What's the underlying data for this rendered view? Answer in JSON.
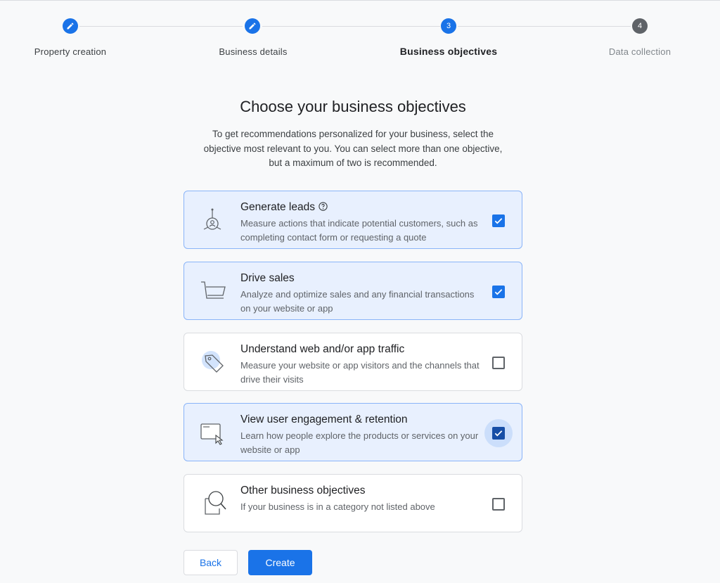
{
  "stepper": {
    "steps": [
      {
        "label": "Property creation",
        "state": "completed",
        "marker": "edit-icon"
      },
      {
        "label": "Business details",
        "state": "completed",
        "marker": "edit-icon"
      },
      {
        "label": "Business objectives",
        "state": "current",
        "number": "3"
      },
      {
        "label": "Data collection",
        "state": "upcoming",
        "number": "4"
      }
    ]
  },
  "page": {
    "title": "Choose your business objectives",
    "subtitle": "To get recommendations personalized for your business, select the objective most relevant to you. You can select more than one objective, but a maximum of two is recommended."
  },
  "objectives": [
    {
      "title": "Generate leads",
      "description": "Measure actions that indicate potential customers, such as completing contact form or requesting a quote",
      "checked": true,
      "icon": "leads-target-icon",
      "help_icon": "help-circle-icon"
    },
    {
      "title": "Drive sales",
      "description": "Analyze and optimize sales and any financial transactions on your website or app",
      "checked": true,
      "icon": "shopping-cart-icon"
    },
    {
      "title": "Understand web and/or app traffic",
      "description": "Measure your website or app visitors and the channels that drive their visits",
      "checked": false,
      "icon": "tag-icon"
    },
    {
      "title": "View user engagement & retention",
      "description": "Learn how people explore the products or services on your website or app",
      "checked": true,
      "icon": "browser-cursor-icon"
    },
    {
      "title": "Other business objectives",
      "description": "If your business is in a category not listed above",
      "checked": false,
      "icon": "magnifier-icon"
    }
  ],
  "buttons": {
    "back": "Back",
    "create": "Create"
  },
  "colors": {
    "accent": "#1a73e8",
    "selected_card_bg": "#e8f0fe",
    "selected_card_border": "#8ab4f8"
  }
}
